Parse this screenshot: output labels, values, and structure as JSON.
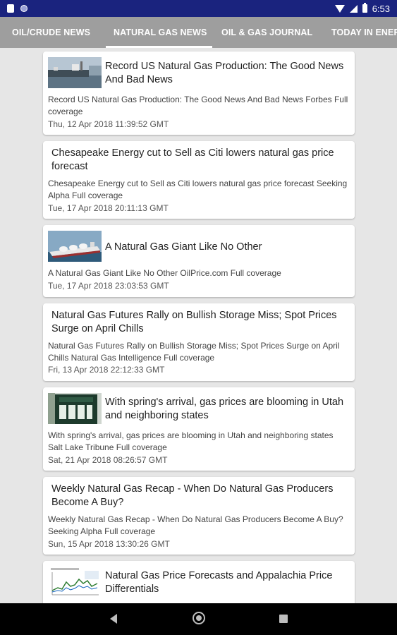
{
  "status_bar": {
    "time": "6:53"
  },
  "tabs": [
    {
      "label": "OIL/CRUDE NEWS"
    },
    {
      "label": "NATURAL GAS NEWS"
    },
    {
      "label": "OIL & GAS JOURNAL"
    },
    {
      "label": "TODAY IN ENER"
    }
  ],
  "selected_tab": "NATURAL GAS NEWS",
  "articles": [
    {
      "headline": "Record US Natural Gas Production: The Good News And Bad News",
      "summary": "Record US Natural Gas Production: The Good News And Bad News Forbes  Full coverage",
      "date": "Thu, 12 Apr 2018 11:39:52 GMT",
      "thumbnail": "ship-harbor"
    },
    {
      "headline": "Chesapeake Energy cut to Sell as Citi lowers natural gas price forecast",
      "summary": "Chesapeake Energy cut to Sell as Citi lowers natural gas price forecast Seeking Alpha  Full coverage",
      "date": "Tue, 17 Apr 2018 20:11:13 GMT"
    },
    {
      "headline": "A Natural Gas Giant Like No Other",
      "summary": "A Natural Gas Giant Like No Other  OilPrice.com  Full coverage",
      "date": "Tue, 17 Apr 2018 23:03:53 GMT",
      "thumbnail": "lng-tanker"
    },
    {
      "headline": "Natural Gas Futures Rally on Bullish Storage Miss; Spot Prices Surge on April Chills",
      "summary": "Natural Gas Futures Rally on Bullish Storage Miss; Spot Prices Surge on April Chills  Natural Gas Intelligence  Full coverage",
      "date": "Fri, 13 Apr 2018 22:12:33 GMT"
    },
    {
      "headline": "With spring's arrival, gas prices are blooming in Utah and neighboring states",
      "summary": "With spring's arrival, gas prices are blooming in Utah and neighboring states  Salt Lake Tribune  Full coverage",
      "date": "Sat, 21 Apr 2018 08:26:57 GMT",
      "thumbnail": "gas-price-sign"
    },
    {
      "headline": "Weekly Natural Gas Recap - When Do Natural Gas Producers Become A Buy?",
      "summary": "Weekly Natural Gas Recap - When Do Natural Gas Producers Become A Buy?  Seeking Alpha  Full coverage",
      "date": "Sun, 15 Apr 2018 13:30:26 GMT"
    },
    {
      "headline": "Natural Gas Price Forecasts and Appalachia Price Differentials",
      "thumbnail": "price-chart"
    }
  ],
  "colors": {
    "status_bar": "#1a237e",
    "tab_bar": "#9e9e9e",
    "background": "#e6e6e6",
    "nav_bar": "#000000"
  }
}
